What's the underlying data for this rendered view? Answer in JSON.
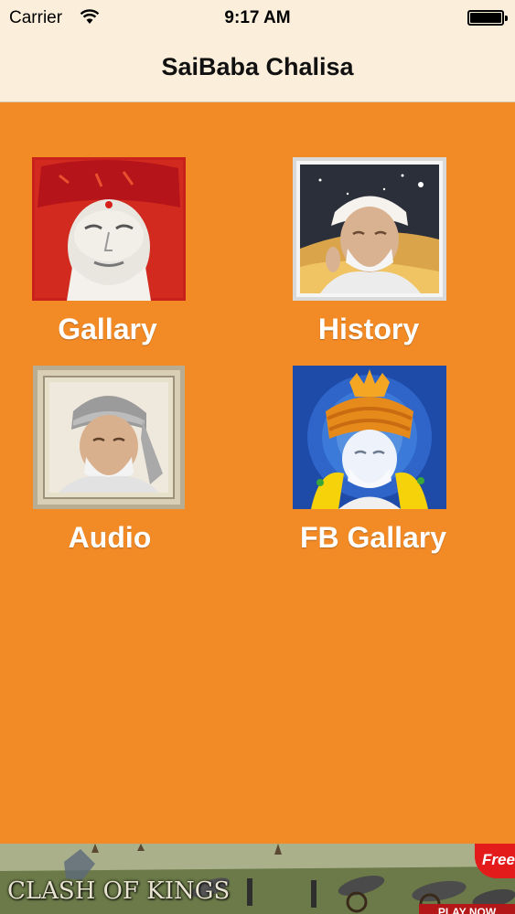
{
  "status": {
    "carrier": "Carrier",
    "time": "9:17 AM"
  },
  "nav": {
    "title": "SaiBaba Chalisa"
  },
  "menu": {
    "items": [
      {
        "label": "Gallary",
        "icon": "saibaba-red-portrait"
      },
      {
        "label": "History",
        "icon": "saibaba-history-portrait"
      },
      {
        "label": "Audio",
        "icon": "saibaba-audio-portrait"
      },
      {
        "label": "FB Gallary",
        "icon": "saibaba-fb-portrait"
      }
    ]
  },
  "ad": {
    "logo": "CLASH OF KINGS",
    "badge": "Free",
    "cta": "PLAY NOW"
  },
  "colors": {
    "background": "#f28a26",
    "bar": "#fbeedb"
  }
}
